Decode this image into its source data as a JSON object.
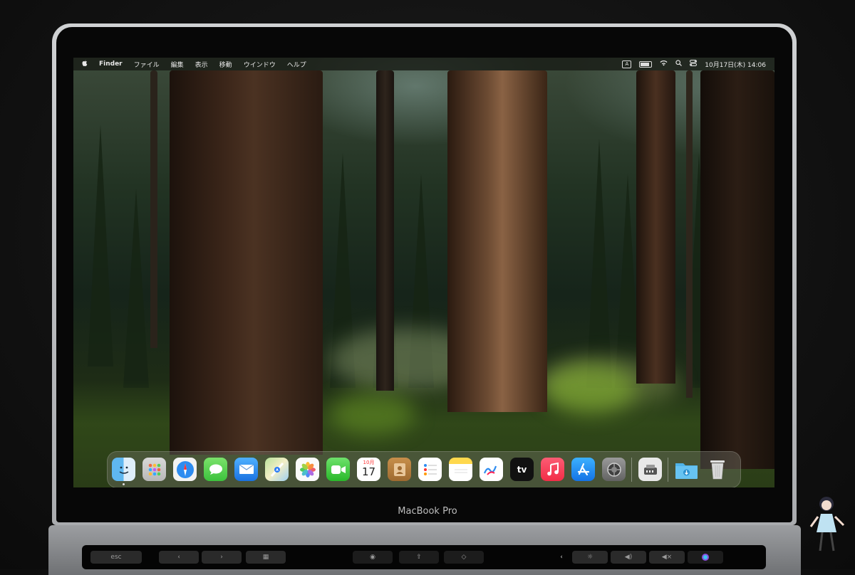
{
  "menubar": {
    "apple_icon": "apple-icon",
    "app_name": "Finder",
    "menus": [
      "ファイル",
      "編集",
      "表示",
      "移動",
      "ウインドウ",
      "ヘルプ"
    ],
    "input_indicator": "A",
    "datetime": "10月17日(木)  14:06"
  },
  "dock": {
    "apps": [
      {
        "name": "Finder",
        "icon": "finder-icon"
      },
      {
        "name": "Launchpad",
        "icon": "launchpad-icon"
      },
      {
        "name": "Safari",
        "icon": "safari-icon"
      },
      {
        "name": "Messages",
        "icon": "messages-icon"
      },
      {
        "name": "Mail",
        "icon": "mail-icon"
      },
      {
        "name": "Maps",
        "icon": "maps-icon"
      },
      {
        "name": "Photos",
        "icon": "photos-icon"
      },
      {
        "name": "FaceTime",
        "icon": "facetime-icon"
      },
      {
        "name": "Calendar",
        "icon": "calendar-icon"
      },
      {
        "name": "Contacts",
        "icon": "contacts-icon"
      },
      {
        "name": "Reminders",
        "icon": "reminders-icon"
      },
      {
        "name": "Notes",
        "icon": "notes-icon"
      },
      {
        "name": "Freeform",
        "icon": "freeform-icon"
      },
      {
        "name": "TV",
        "icon": "tv-icon"
      },
      {
        "name": "Music",
        "icon": "music-icon"
      },
      {
        "name": "App Store",
        "icon": "app-store-icon"
      },
      {
        "name": "System Settings",
        "icon": "settings-icon"
      },
      {
        "name": "Utility",
        "icon": "utility-icon"
      },
      {
        "name": "Downloads",
        "icon": "downloads-folder-icon"
      },
      {
        "name": "Trash",
        "icon": "trash-icon"
      }
    ],
    "calendar_month": "10月",
    "calendar_day": "17",
    "tv_label": "tv"
  },
  "device": {
    "brand": "MacBook Pro"
  },
  "touchbar": {
    "esc": "esc"
  },
  "colors": {
    "accent": "#0a84ff",
    "dock_bg": "#787870",
    "menubar_bg": "#1c1e17"
  }
}
